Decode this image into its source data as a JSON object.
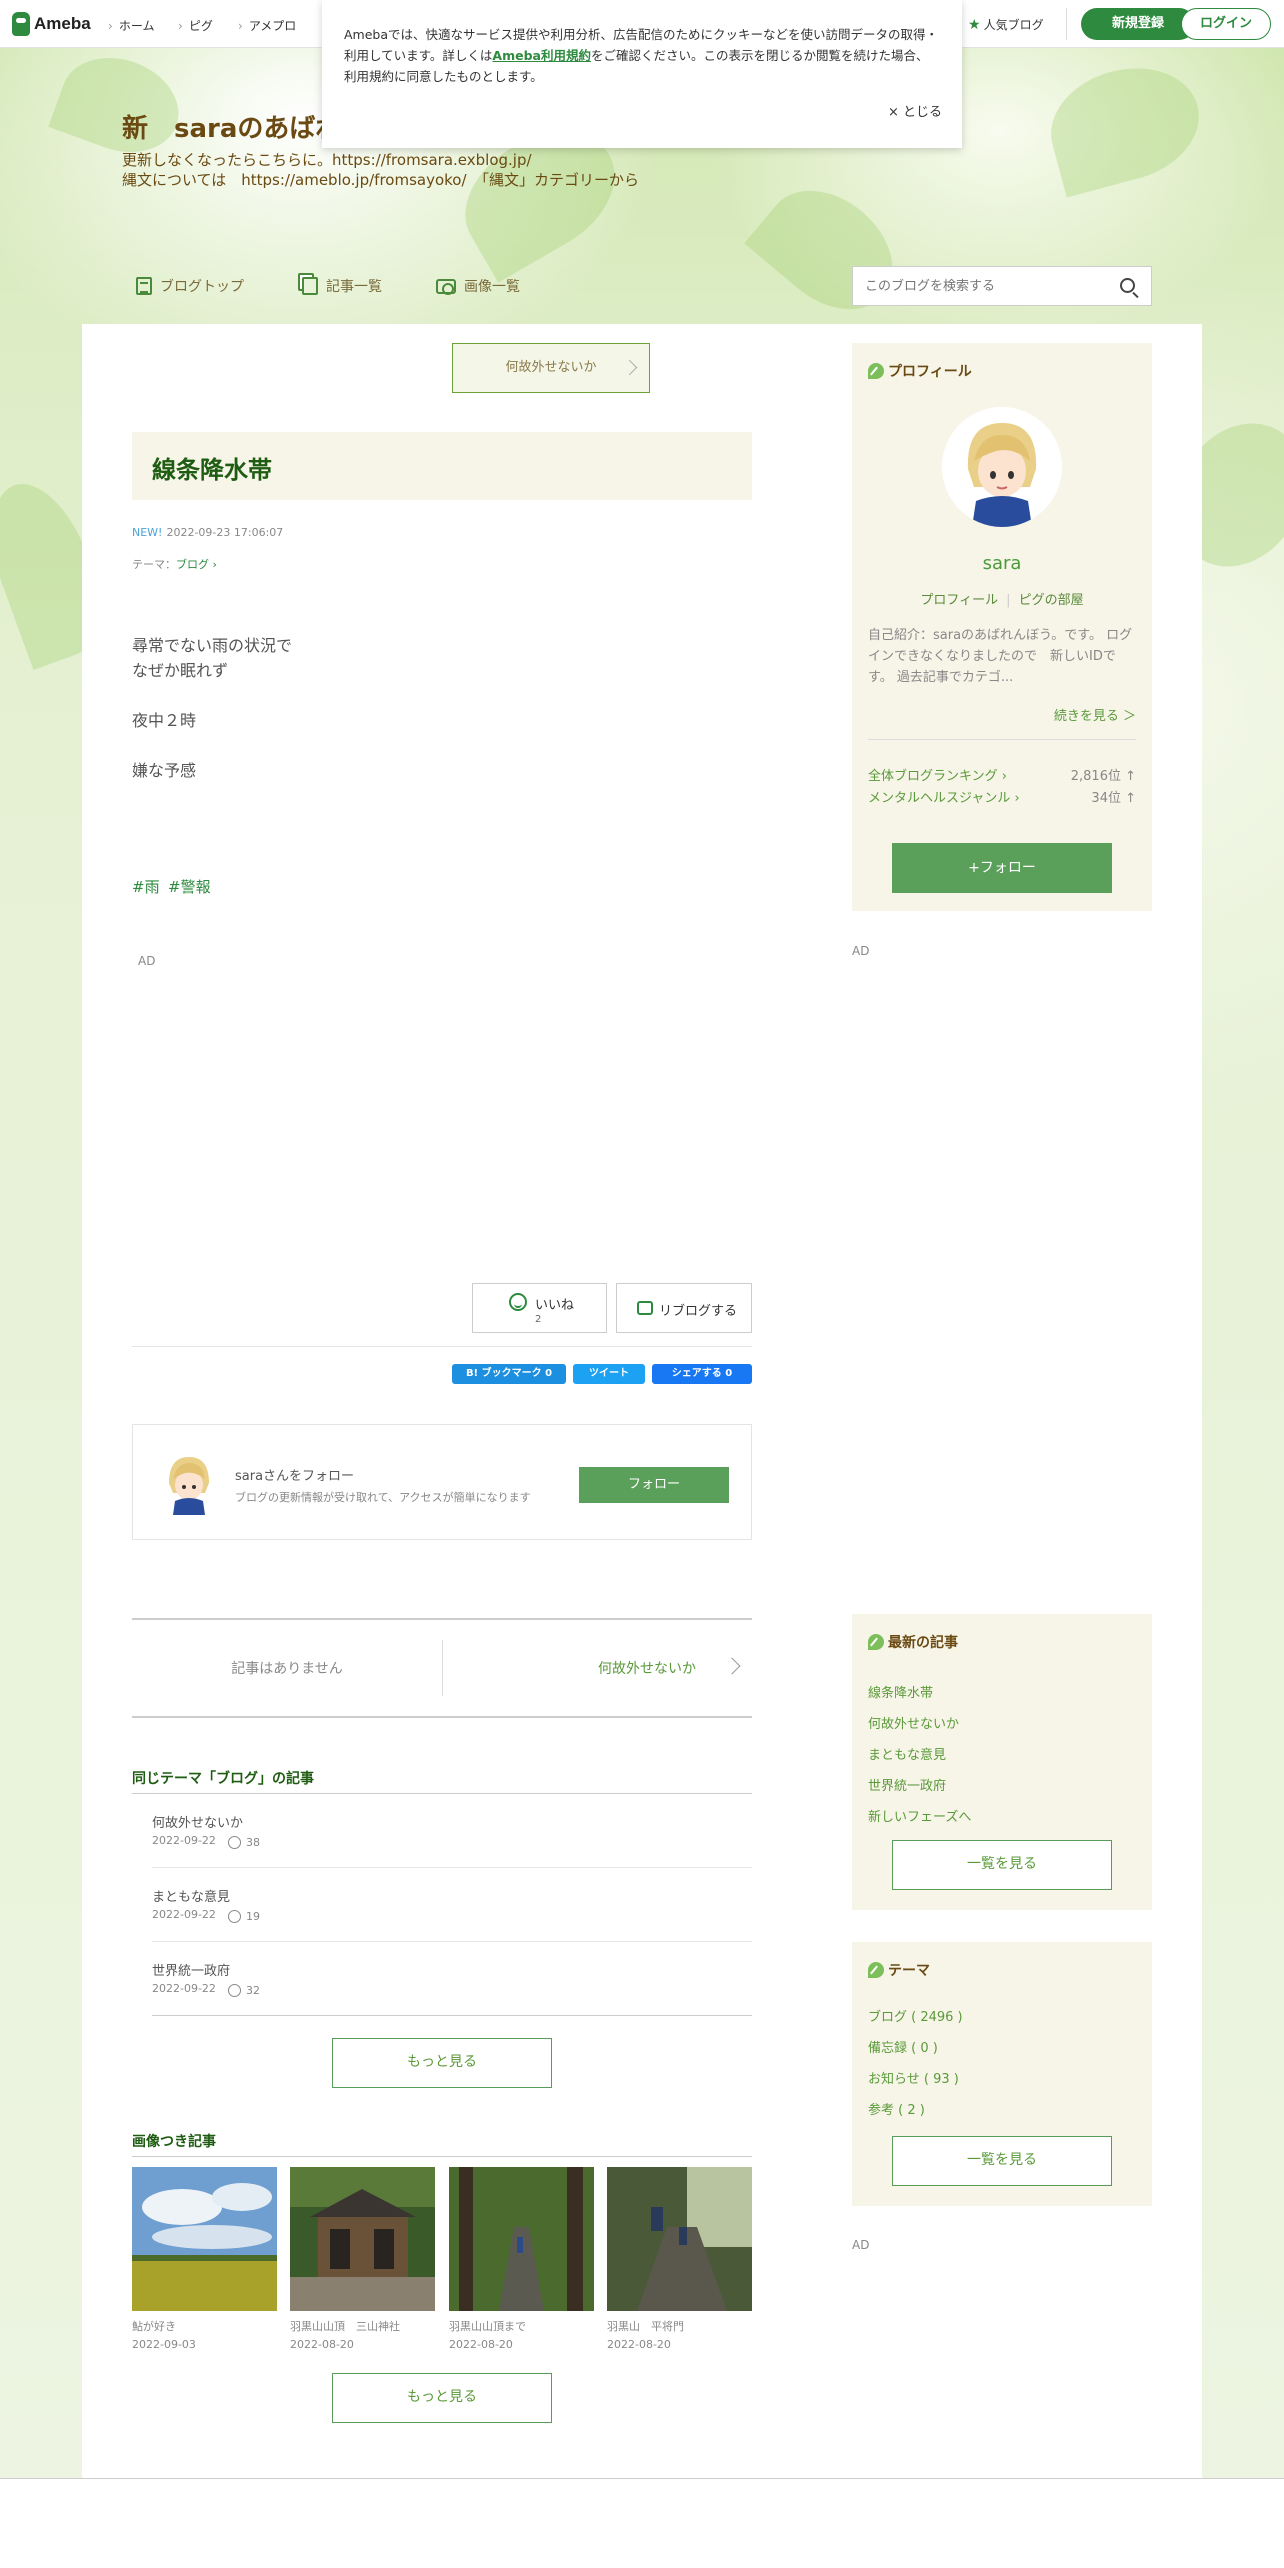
{
  "topbar": {
    "logo_text": "Ameba",
    "nav": [
      "ホーム",
      "ピグ",
      "アメプロ"
    ],
    "popular_blog": "人気ブログ",
    "signup": "新規登録",
    "login": "ログイン"
  },
  "cookie": {
    "text_before": "Amebaでは、快適なサービス提供や利用分析、広告配信のためにクッキーなどを使い訪問データの取得・利用しています。詳しくは",
    "link": "Ameba利用規約",
    "text_after": "をご確認ください。この表示を閉じるか閲覧を続けた場合、利用規約に同意したものとします。",
    "close": "× とじる"
  },
  "header": {
    "title": "新　saraのあばれ",
    "desc1": "更新しなくなったらこちらに。https://fromsara.exblog.jp/",
    "desc2": "縄文については　https://ameblo.jp/fromsayoko/　「縄文」カテゴリーから",
    "nav": [
      "ブログトップ",
      "記事一覧",
      "画像一覧"
    ],
    "search_placeholder": "このブログを検索する"
  },
  "article": {
    "next_top": "何故外せないか",
    "title": "線条降水帯",
    "new_label": "NEW!",
    "date": "2022-09-23 17:06:07",
    "theme_label": "テーマ：",
    "theme": "ブログ",
    "body": [
      "尋常でない雨の状況で",
      "なぜか眠れず",
      "夜中２時",
      "嫌な予感"
    ],
    "tags": [
      "#雨",
      "#警報"
    ],
    "ad": "AD",
    "like_label": "いいね",
    "like_count": "2",
    "reblog": "リブログする",
    "share": [
      "B! ブックマーク 0",
      "ツイート",
      "シェアする 0"
    ]
  },
  "follow_box": {
    "name": "saraさんをフォロー",
    "sub": "ブログの更新情報が受け取れて、アクセスが簡単になります",
    "button": "フォロー"
  },
  "pager": {
    "prev": "記事はありません",
    "next": "何故外せないか"
  },
  "same_theme": {
    "heading": "同じテーマ「ブログ」の記事",
    "items": [
      {
        "title": "何故外せないか",
        "date": "2022-09-22",
        "likes": "38"
      },
      {
        "title": "まともな意見",
        "date": "2022-09-22",
        "likes": "19"
      },
      {
        "title": "世界統一政府",
        "date": "2022-09-22",
        "likes": "32"
      }
    ],
    "more": "もっと見る"
  },
  "image_posts": {
    "heading": "画像つき記事",
    "items": [
      {
        "title": "鮎が好き",
        "date": "2022-09-03"
      },
      {
        "title": "羽黒山山頂　三山神社",
        "date": "2022-08-20"
      },
      {
        "title": "羽黒山山頂まで",
        "date": "2022-08-20"
      },
      {
        "title": "羽黒山　平将門",
        "date": "2022-08-20"
      }
    ],
    "more": "もっと見る"
  },
  "sidebar": {
    "profile": {
      "heading": "プロフィール",
      "name": "sara",
      "link1": "プロフィール",
      "link2": "ピグの部屋",
      "intro": "自己紹介：saraのあばれんぼう。です。 ログインできなくなりましたので　新しいIDです。 過去記事でカテゴ...",
      "continue": "続きを見る ＞",
      "rank1_label": "全体ブログランキング",
      "rank1_value": "2,816位 ↑",
      "rank2_label": "メンタルヘルスジャンル",
      "rank2_value": "34位 ↑",
      "follow": "+フォロー"
    },
    "ad1": "AD",
    "latest": {
      "heading": "最新の記事",
      "items": [
        "線条降水帯",
        "何故外せないか",
        "まともな意見",
        "世界統一政府",
        "新しいフェーズへ"
      ],
      "more": "一覧を見る"
    },
    "themes": {
      "heading": "テーマ",
      "items": [
        "ブログ ( 2496 )",
        "備忘録 ( 0 )",
        "お知らせ ( 93 )",
        "参考 ( 2 )"
      ],
      "more": "一覧を見る"
    },
    "ad2": "AD"
  },
  "colors": {
    "accent": "#2d8a3e",
    "title_brown": "#6a4a12",
    "panel_beige": "#f7f4e8"
  }
}
